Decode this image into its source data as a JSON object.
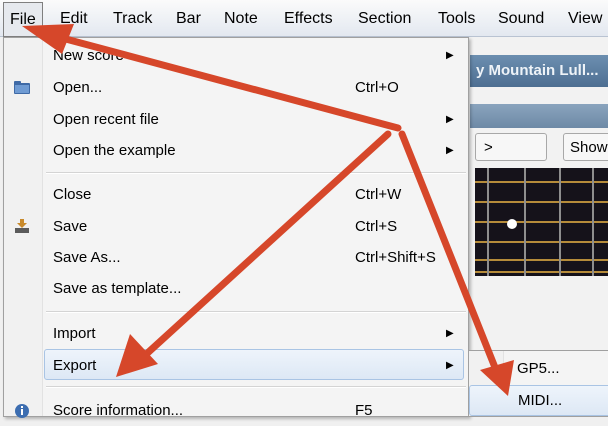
{
  "menubar": {
    "items": [
      "File",
      "Edit",
      "Track",
      "Bar",
      "Note",
      "Effects",
      "Section",
      "Tools",
      "Sound",
      "View"
    ]
  },
  "background": {
    "window_title": "y Mountain Lull...",
    "btn_next": ">",
    "btn_show": "Show"
  },
  "file_menu": {
    "items": [
      {
        "label": "New score",
        "shortcut": "",
        "submenu": true,
        "icon": ""
      },
      {
        "label": "Open...",
        "shortcut": "Ctrl+O",
        "submenu": false,
        "icon": "folder-icon"
      },
      {
        "label": "Open recent file",
        "shortcut": "",
        "submenu": true,
        "icon": ""
      },
      {
        "label": "Open the example",
        "shortcut": "",
        "submenu": true,
        "icon": ""
      },
      {
        "label": "Close",
        "shortcut": "Ctrl+W",
        "submenu": false,
        "icon": ""
      },
      {
        "label": "Save",
        "shortcut": "Ctrl+S",
        "submenu": false,
        "icon": "save-icon"
      },
      {
        "label": "Save As...",
        "shortcut": "Ctrl+Shift+S",
        "submenu": false,
        "icon": ""
      },
      {
        "label": "Save as template...",
        "shortcut": "",
        "submenu": false,
        "icon": ""
      },
      {
        "label": "Import",
        "shortcut": "",
        "submenu": true,
        "icon": ""
      },
      {
        "label": "Export",
        "shortcut": "",
        "submenu": true,
        "icon": ""
      },
      {
        "label": "Score information...",
        "shortcut": "F5",
        "submenu": false,
        "icon": "info-icon"
      }
    ],
    "arrow_glyph": "▶"
  },
  "export_submenu": {
    "items": [
      "GP5...",
      "MIDI..."
    ]
  },
  "colors": {
    "annotation_arrow": "#d6472a",
    "highlight_border": "#a9c4e4"
  }
}
